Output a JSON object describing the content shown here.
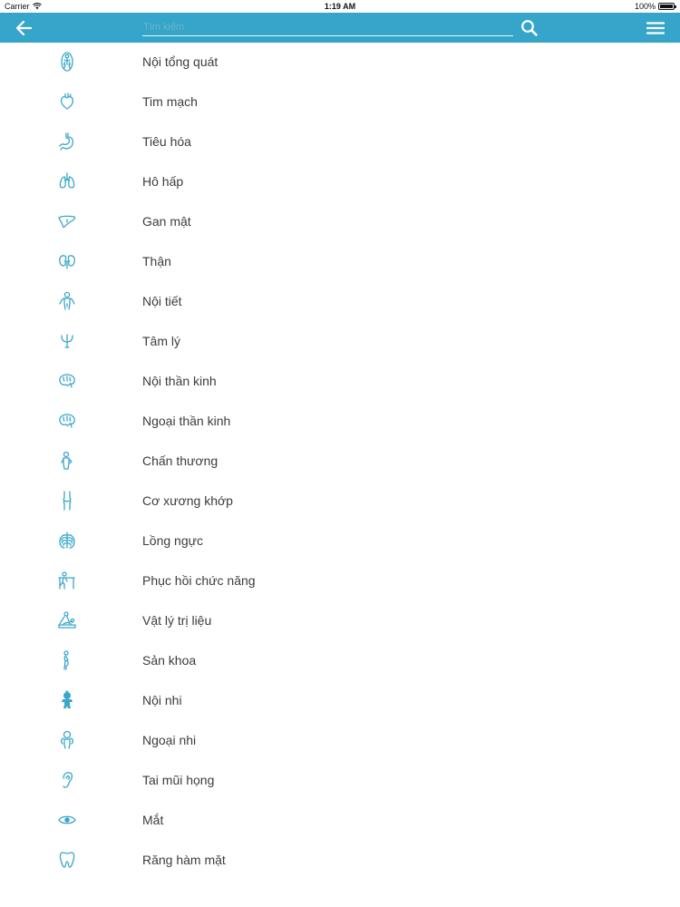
{
  "status_bar": {
    "carrier": "Carrier",
    "time": "1:19 AM",
    "battery": "100%"
  },
  "header": {
    "search_placeholder": "Tìm kiếm",
    "background_color": "#35a5c9",
    "icons": {
      "back": "arrow-left-icon",
      "search": "search-icon",
      "menu": "hamburger-menu-icon"
    }
  },
  "list": {
    "accent_color": "#3aa6c8",
    "items": [
      {
        "label": "Nội tổng quát",
        "icon": "body-icon"
      },
      {
        "label": "Tim mạch",
        "icon": "heart-icon"
      },
      {
        "label": "Tiêu hóa",
        "icon": "stomach-icon"
      },
      {
        "label": "Hô hấp",
        "icon": "lungs-icon"
      },
      {
        "label": "Gan mật",
        "icon": "liver-icon"
      },
      {
        "label": "Thận",
        "icon": "kidney-icon"
      },
      {
        "label": "Nội tiết",
        "icon": "endocrine-icon"
      },
      {
        "label": "Tâm lý",
        "icon": "psi-icon"
      },
      {
        "label": "Nội thần kinh",
        "icon": "brain-icon"
      },
      {
        "label": "Ngoại thần kinh",
        "icon": "brain-icon"
      },
      {
        "label": "Chấn thương",
        "icon": "injury-icon"
      },
      {
        "label": "Cơ xương khớp",
        "icon": "joint-icon"
      },
      {
        "label": "Lồng ngực",
        "icon": "ribcage-icon"
      },
      {
        "label": "Phục hồi chức năng",
        "icon": "rehabilitation-icon"
      },
      {
        "label": "Vật lý trị liệu",
        "icon": "physiotherapy-icon"
      },
      {
        "label": "Sản khoa",
        "icon": "pregnant-icon"
      },
      {
        "label": "Nội nhi",
        "icon": "baby-icon"
      },
      {
        "label": "Ngoại nhi",
        "icon": "child-icon"
      },
      {
        "label": "Tai mũi họng",
        "icon": "ear-icon"
      },
      {
        "label": "Mắt",
        "icon": "eye-icon"
      },
      {
        "label": "Răng hàm mặt",
        "icon": "tooth-icon"
      }
    ]
  }
}
